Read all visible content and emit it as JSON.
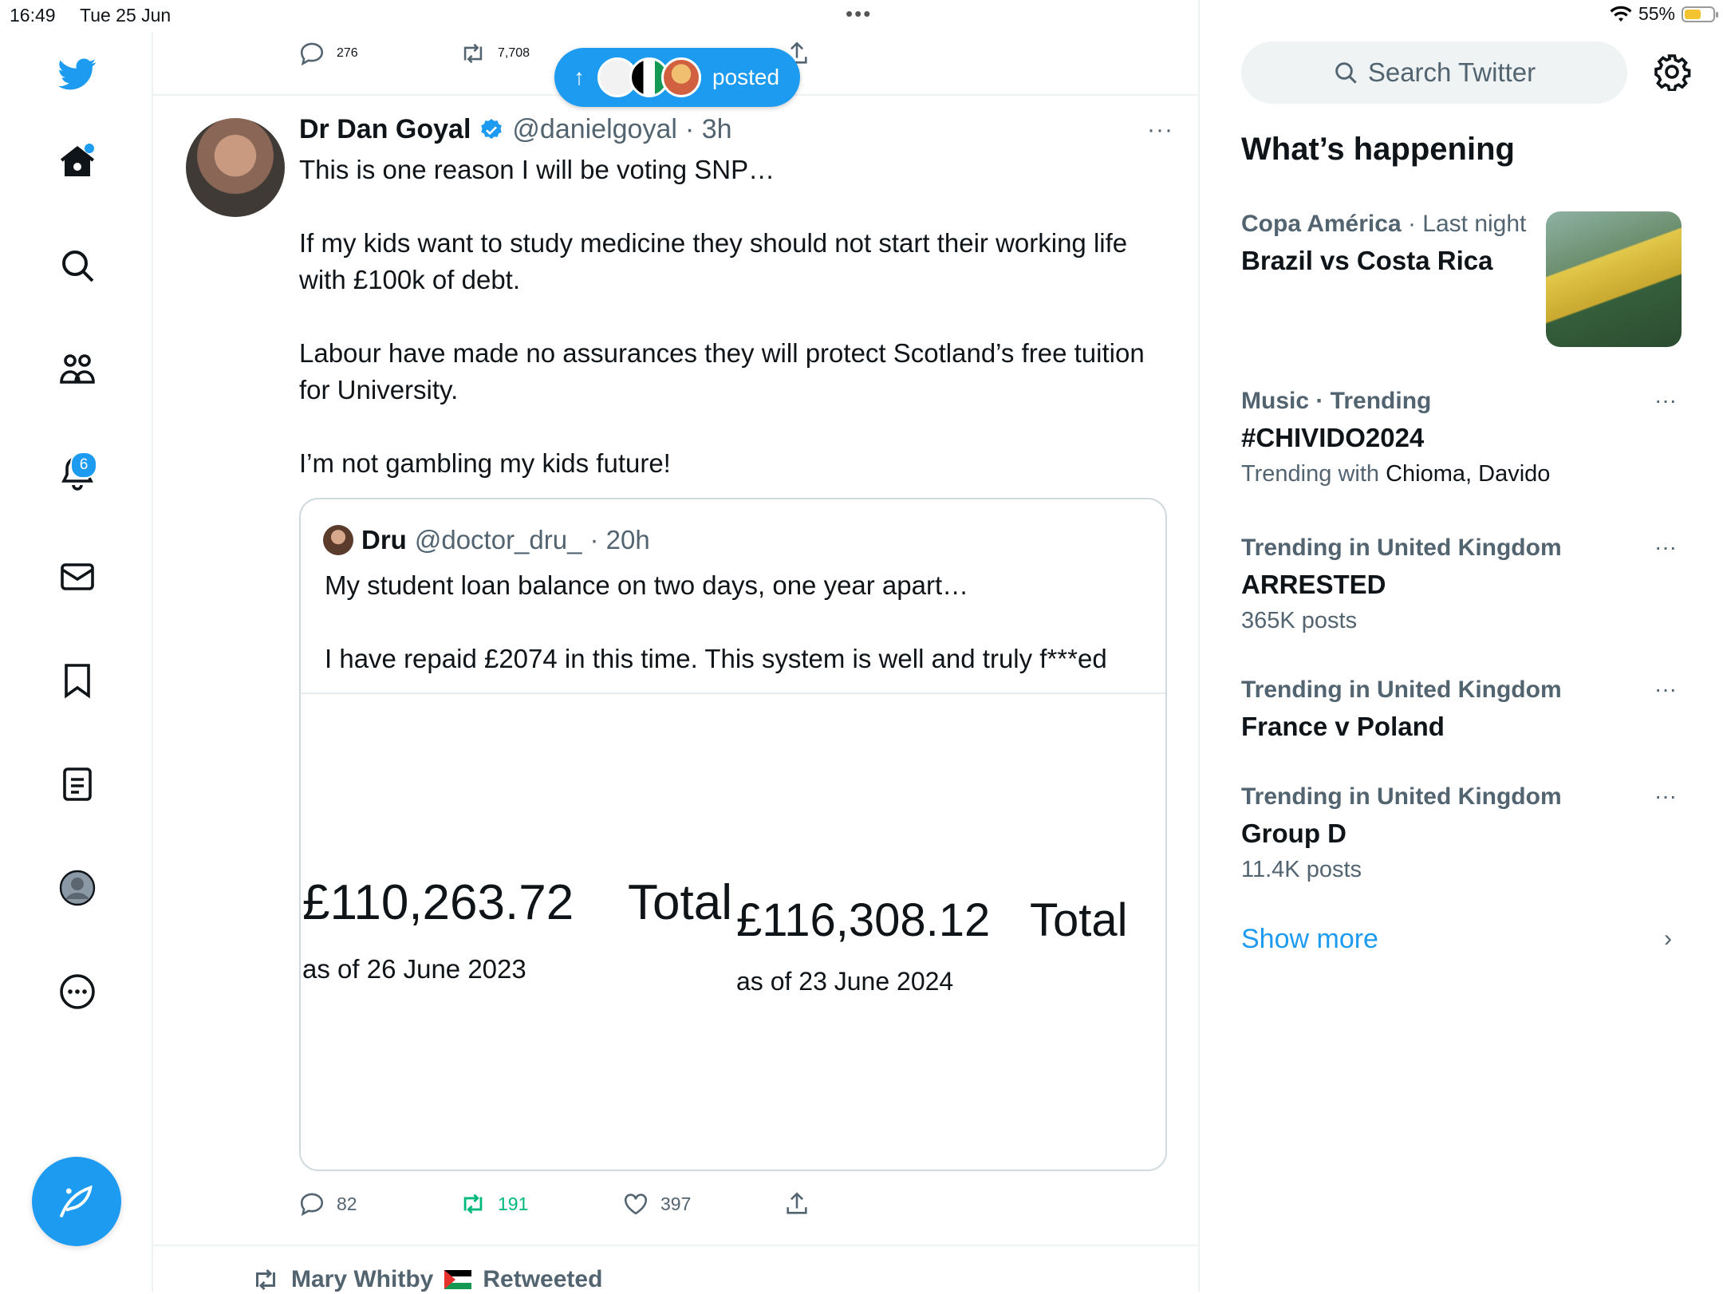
{
  "status_bar": {
    "time": "16:49",
    "date": "Tue 25 Jun",
    "battery": "55%"
  },
  "nav": {
    "notifications_badge": "6"
  },
  "prev_tweet": {
    "replies": "276",
    "retweets": "7,708"
  },
  "posted_pill": {
    "label": "posted"
  },
  "tweet": {
    "name": "Dr Dan Goyal",
    "handle": "@danielgoyal",
    "age": "· 3h",
    "more": "···",
    "text": "This is one reason I will be voting SNP…\n\nIf my kids want to study medicine they should not start their working life with £100k of debt.\n\nLabour have made no assurances they will protect Scotland’s free tuition for University.\n\nI’m not gambling my kids future!",
    "quote": {
      "name": "Dru",
      "handle": "@doctor_dru_",
      "age": "· 20h",
      "text": "My student loan balance on two days, one year apart…\n\nI have repaid £2074 in this time. This system is well and truly f***ed",
      "image": {
        "amount1": "£110,263.72",
        "total1": "Total",
        "date1": "as of 26 June 2023",
        "amount2": "£116,308.12",
        "total2": "Total",
        "date2": "as of 23 June 2024"
      }
    },
    "replies": "82",
    "retweets": "191",
    "likes": "397"
  },
  "next_retweet": {
    "user": "Mary Whitby",
    "label": "Retweeted"
  },
  "search": {
    "placeholder": "Search Twitter"
  },
  "whats_happening": {
    "title": "What’s happening",
    "trends": [
      {
        "category": "Copa América",
        "meta": " · Last night",
        "title": "Brazil vs Costa Rica",
        "sub": ""
      },
      {
        "category": "Music · Trending",
        "meta": "",
        "title": "#CHIVIDO2024",
        "sub_prefix": "Trending with ",
        "sub_names": "Chioma, Davido"
      },
      {
        "category": "Trending in United Kingdom",
        "meta": "",
        "title": "ARRESTED",
        "sub": "365K posts"
      },
      {
        "category": "Trending in United Kingdom",
        "meta": "",
        "title": "France v Poland",
        "sub": ""
      },
      {
        "category": "Trending in United Kingdom",
        "meta": "",
        "title": "Group D",
        "sub": "11.4K posts"
      }
    ],
    "show_more": "Show more"
  },
  "colors": {
    "accent": "#1d9bf0",
    "retweet_green": "#00ba7c",
    "muted": "#536471"
  },
  "icons": [
    "twitter-logo-icon",
    "home-icon",
    "search-icon",
    "communities-icon",
    "bell-icon",
    "mail-icon",
    "bookmark-icon",
    "lists-icon",
    "profile-icon",
    "more-circle-icon",
    "compose-icon",
    "reply-icon",
    "retweet-icon",
    "like-icon",
    "share-icon",
    "gear-icon",
    "verified-icon",
    "chevron-right-icon"
  ]
}
